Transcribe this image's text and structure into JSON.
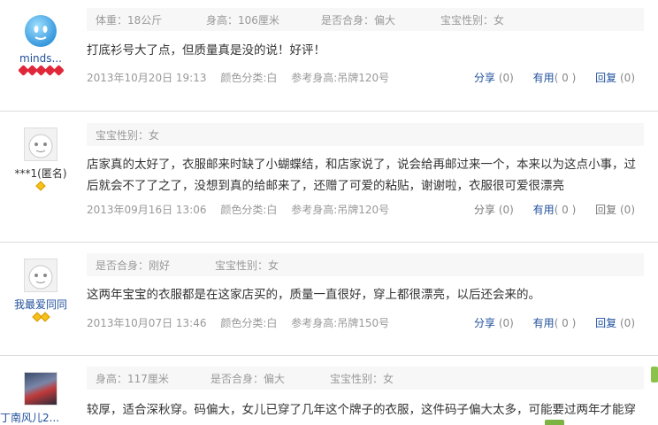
{
  "reviews": [
    {
      "username": "minds...",
      "avatar": "qq-bubble-avatar",
      "badge": "red-hearts",
      "attrs": [
        "体重：18公斤",
        "身高：106厘米",
        "是否合身：偏大",
        "宝宝性别：女"
      ],
      "text": "打底衫号大了点，但质量真是没的说！好评！",
      "date": "2013年10月20日 19:13",
      "color": "颜色分类:白",
      "size": "参考身高:吊牌120号",
      "share": "分享",
      "share_count": "(0)",
      "useful": "有用",
      "useful_count": "( 0 )",
      "reply": "回复",
      "reply_count": "(0)"
    },
    {
      "username": "***1(匿名)",
      "avatar": "default-avatar",
      "badge": "gold-diamond",
      "attrs": [
        "宝宝性别：女"
      ],
      "text": "店家真的太好了，衣服邮来时缺了小蝴蝶结，和店家说了，说会给再邮过来一个，本来以为这点小事，过后就会不了了之了，没想到真的给邮来了，还赠了可爱的粘贴，谢谢啦，衣服很可爱很漂亮",
      "date": "2013年09月16日 13:06",
      "color": "颜色分类:白",
      "size": "参考身高:吊牌120号",
      "share": "分享",
      "share_count": "(0)",
      "useful": "有用",
      "useful_count": "( 0 )",
      "reply": "回复",
      "reply_count": "(0)"
    },
    {
      "username": "我最爱同同",
      "avatar": "default-avatar",
      "badge": "gold-diamonds",
      "attrs": [
        "是否合身：刚好",
        "宝宝性别：女"
      ],
      "text": "这两年宝宝的衣服都是在这家店买的，质量一直很好，穿上都很漂亮，以后还会来的。",
      "date": "2013年10月07日 13:46",
      "color": "颜色分类:白",
      "size": "参考身高:吊牌150号",
      "share": "分享",
      "share_count": "(0)",
      "useful": "有用",
      "useful_count": "( 0 )",
      "reply": "回复",
      "reply_count": "(0)"
    },
    {
      "username": "丁南风儿2...",
      "avatar": "photo-avatar",
      "attrs": [
        "身高：117厘米",
        "是否合身：偏大",
        "宝宝性别：女"
      ],
      "text": "较厚，适合深秋穿。码偏大，女儿已穿了几年这个牌子的衣服，这件码子偏大太多，可能要过两年才能穿"
    }
  ],
  "colors": {
    "link": "#1f4f9b",
    "muted": "#999999",
    "heart": "#e0283a",
    "diamond": "#f5c11a",
    "attr_bg": "#f7f7f7"
  }
}
